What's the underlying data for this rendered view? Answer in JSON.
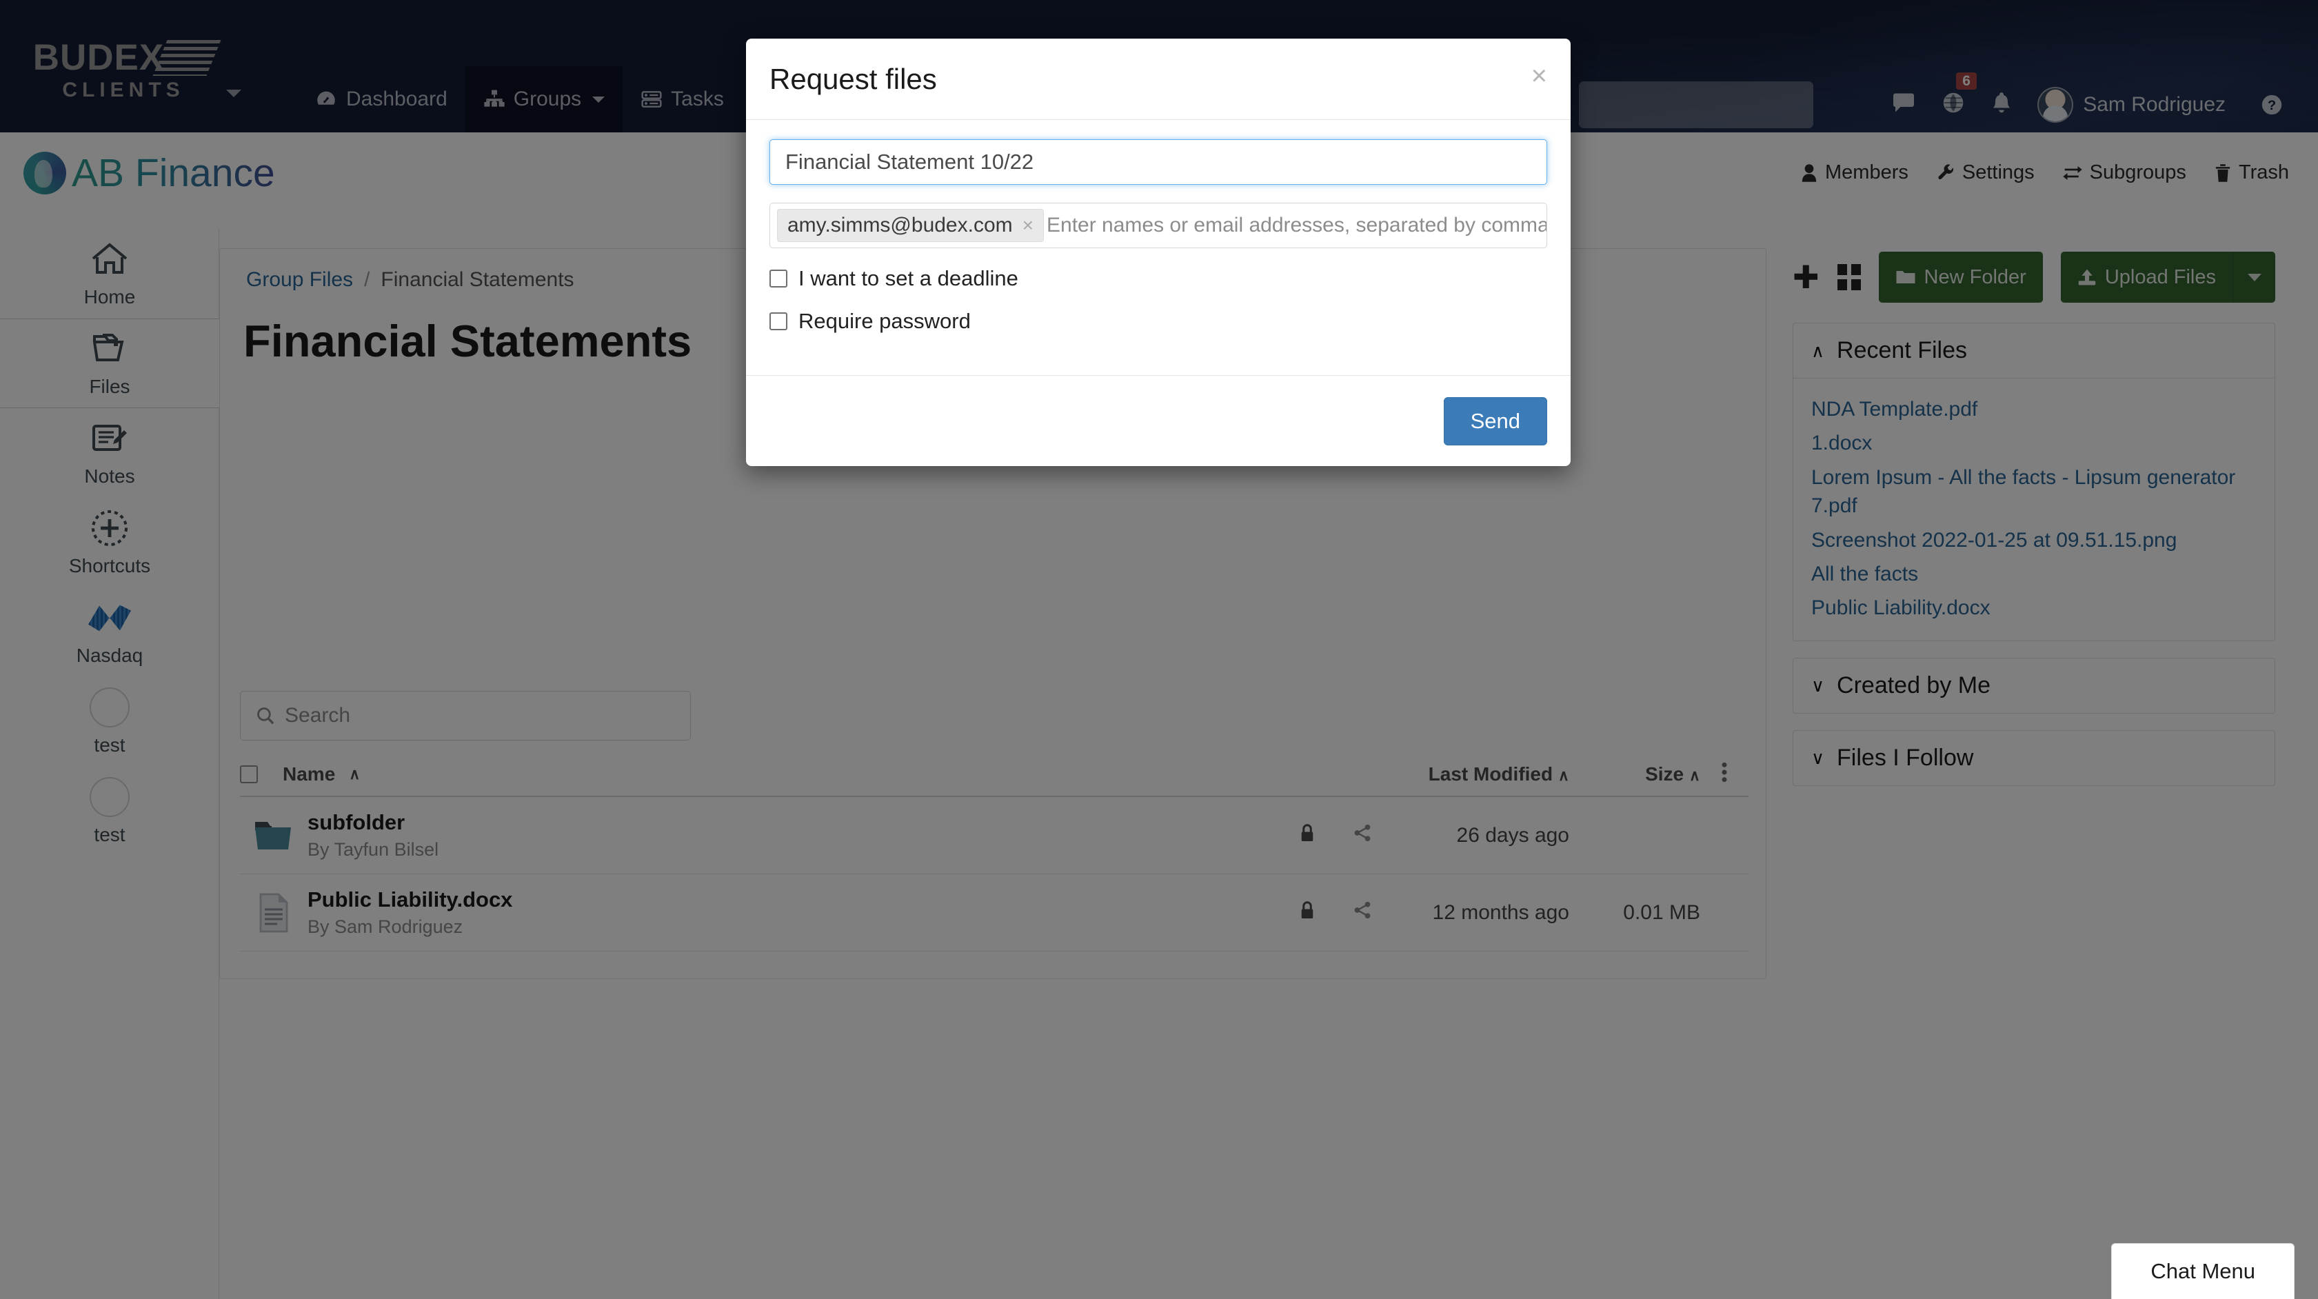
{
  "app": {
    "brand_line1": "BUDEX",
    "brand_line2": "CLIENTS"
  },
  "navbar": {
    "items": [
      {
        "label": "Dashboard",
        "icon": "dashboard-icon",
        "active": false,
        "caret": false
      },
      {
        "label": "Groups",
        "icon": "groups-icon",
        "active": true,
        "caret": true
      },
      {
        "label": "Tasks",
        "icon": "tasks-icon",
        "active": false,
        "caret": false
      },
      {
        "label": "",
        "icon": "announcements-megaphone-icon",
        "active": false,
        "caret": false
      }
    ],
    "search_placeholder": "",
    "search_value": "",
    "messages_icon": "chat-bubble-icon",
    "globe_icon": "globe-icon",
    "globe_badge": "6",
    "bell_icon": "bell-icon",
    "user_name": "Sam Rodriguez",
    "help_icon": "help-circle-icon"
  },
  "group_header": {
    "name": "AB Finance",
    "tools": [
      {
        "label": "Members",
        "icon": "person-icon"
      },
      {
        "label": "Settings",
        "icon": "wrench-icon"
      },
      {
        "label": "Subgroups",
        "icon": "exchange-arrows-icon"
      },
      {
        "label": "Trash",
        "icon": "trash-icon"
      }
    ]
  },
  "rail": {
    "items": [
      {
        "label": "Home",
        "icon": "home-icon",
        "active": false
      },
      {
        "label": "Files",
        "icon": "folder-file-icon",
        "active": true
      },
      {
        "label": "Notes",
        "icon": "notes-pencil-icon",
        "active": false
      },
      {
        "label": "Shortcuts",
        "icon": "plus-circle-dashed-icon",
        "active": false
      },
      {
        "label": "Nasdaq",
        "icon": "nasdaq-logo-icon",
        "active": false
      },
      {
        "label": "test",
        "icon": "empty-circle-icon",
        "active": false
      },
      {
        "label": "test",
        "icon": "empty-circle-icon",
        "active": false
      }
    ]
  },
  "main": {
    "breadcrumb": {
      "root": "Group Files",
      "separator": "/",
      "current": "Financial Statements"
    },
    "title": "Financial Statements",
    "search_placeholder": "Search",
    "search_value": "",
    "table": {
      "headers": {
        "name": "Name",
        "last_modified": "Last Modified",
        "size": "Size",
        "sort_caret": "∧",
        "menu_icon": "kebab-menu-icon"
      },
      "rows": [
        {
          "icon": "folder-icon",
          "name": "subfolder",
          "by_label": "By",
          "by": "Tayfun Bilsel",
          "lock_icon": "lock-icon",
          "share_icon": "share-icon",
          "last_modified": "26 days ago",
          "size": ""
        },
        {
          "icon": "document-icon",
          "name": "Public Liability.docx",
          "by_label": "By",
          "by": "Sam Rodriguez",
          "lock_icon": "lock-icon",
          "share_icon": "share-icon",
          "last_modified": "12 months ago",
          "size": "0.01 MB"
        }
      ]
    }
  },
  "right_sidebar": {
    "add_icon": "plus-icon",
    "grid_icon": "grid-view-icon",
    "new_folder_label": "New Folder",
    "new_folder_icon": "folder-icon",
    "upload_label": "Upload Files",
    "upload_icon": "upload-icon",
    "upload_caret_icon": "caret-down-icon",
    "panels": [
      {
        "title": "Recent Files",
        "expanded": true,
        "chevron": "∧",
        "links": [
          "NDA Template.pdf",
          "1.docx",
          "Lorem Ipsum - All the facts - Lipsum generator 7.pdf",
          "Screenshot 2022-01-25 at 09.51.15.png",
          "All the facts",
          "Public Liability.docx"
        ]
      },
      {
        "title": "Created by Me",
        "expanded": false,
        "chevron": "∨",
        "links": []
      },
      {
        "title": "Files I Follow",
        "expanded": false,
        "chevron": "∨",
        "links": []
      }
    ]
  },
  "chat": {
    "label": "Chat Menu"
  },
  "modal": {
    "title": "Request files",
    "close_icon": "close-x-icon",
    "name_value": "Financial Statement 10/22",
    "name_placeholder": "",
    "recipient_tag": "amy.simms@budex.com",
    "recipient_tag_remove": "×",
    "recipients_placeholder": "Enter names or email addresses, separated by comma",
    "checkbox_deadline": "I want to set a deadline",
    "checkbox_password": "Require password",
    "deadline_checked": false,
    "password_checked": false,
    "send_label": "Send"
  },
  "colors": {
    "navbar_bg": "#151d36",
    "accent_blue": "#3b7cb8",
    "link_blue": "#2a6496",
    "button_green": "#34642f",
    "badge_red": "#a94442"
  }
}
